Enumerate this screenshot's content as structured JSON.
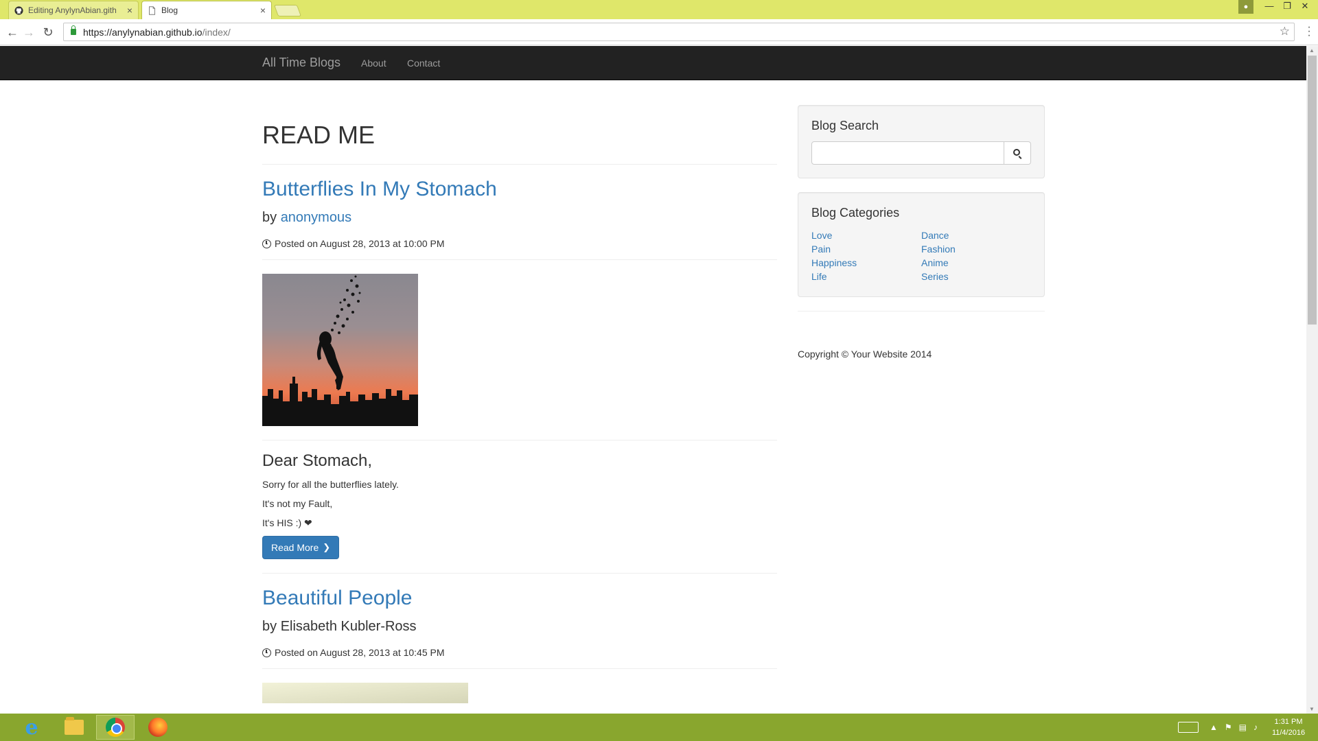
{
  "browser": {
    "tabs": [
      {
        "label": "Editing AnylynAbian.gith",
        "close": "×"
      },
      {
        "label": "Blog",
        "close": "×"
      }
    ],
    "url": {
      "host": "https://anylynabian.github.io",
      "path": "/index/"
    }
  },
  "navbar": {
    "brand": "All Time Blogs",
    "links": [
      "About",
      "Contact"
    ]
  },
  "main": {
    "page_heading": "READ ME",
    "posts": [
      {
        "title": "Butterflies In My Stomach",
        "by_prefix": "by",
        "author": "anonymous",
        "posted": "Posted on August 28, 2013 at 10:00 PM",
        "excerpt_heading": "Dear Stomach,",
        "excerpt_lines": [
          "Sorry for all the butterflies lately.",
          "It's not my Fault,",
          "It's HIS :) ❤"
        ],
        "read_more": "Read More"
      },
      {
        "title": "Beautiful People",
        "by_prefix": "by",
        "author": "Elisabeth Kubler-Ross",
        "posted": "Posted on August 28, 2013 at 10:45 PM"
      }
    ]
  },
  "sidebar": {
    "search_title": "Blog Search",
    "search_placeholder": "",
    "categories_title": "Blog Categories",
    "categories_left": [
      "Love",
      "Pain",
      "Happiness",
      "Life"
    ],
    "categories_right": [
      "Dance",
      "Fashion",
      "Anime",
      "Series"
    ],
    "copyright": "Copyright © Your Website 2014"
  },
  "taskbar": {
    "time": "1:31 PM",
    "date": "11/4/2016"
  },
  "colors": {
    "titlebar": "#dfe76a",
    "navbar": "#222222",
    "link": "#337ab7",
    "taskbar": "#89a62e"
  }
}
